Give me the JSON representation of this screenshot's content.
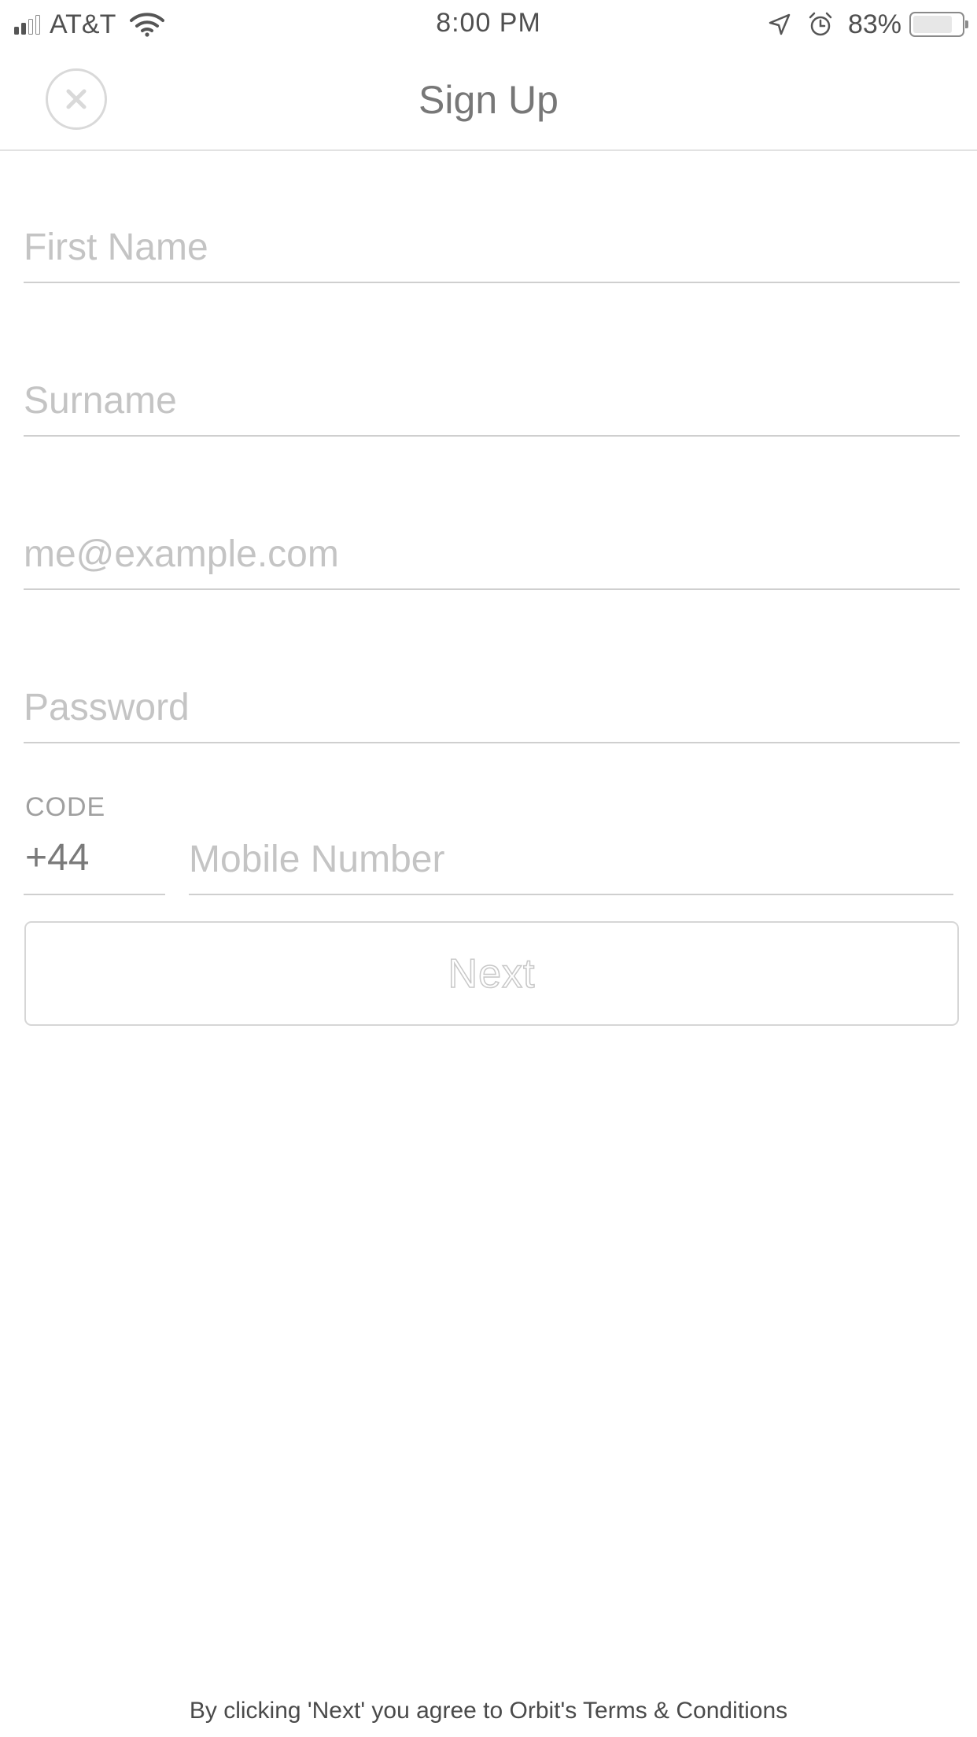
{
  "status_bar": {
    "carrier": "AT&T",
    "time": "8:00 PM",
    "battery_percent": "83%",
    "battery_level": 0.83,
    "signal_bars_filled": 2,
    "signal_bars_total": 4
  },
  "header": {
    "title": "Sign Up",
    "close_icon": "close-circle-icon"
  },
  "form": {
    "first_name": {
      "placeholder": "First Name",
      "value": ""
    },
    "surname": {
      "placeholder": "Surname",
      "value": ""
    },
    "email": {
      "placeholder": "me@example.com",
      "value": ""
    },
    "password": {
      "placeholder": "Password",
      "value": ""
    },
    "code": {
      "label": "CODE",
      "value": "+44"
    },
    "mobile": {
      "placeholder": "Mobile Number",
      "value": ""
    },
    "next_label": "Next"
  },
  "footer": {
    "terms_text": "By clicking 'Next' you agree to Orbit's Terms & Conditions"
  },
  "colors": {
    "text_primary": "#777777",
    "placeholder": "#c4c4c4",
    "divider": "#cfcfcf",
    "background": "#ffffff"
  }
}
